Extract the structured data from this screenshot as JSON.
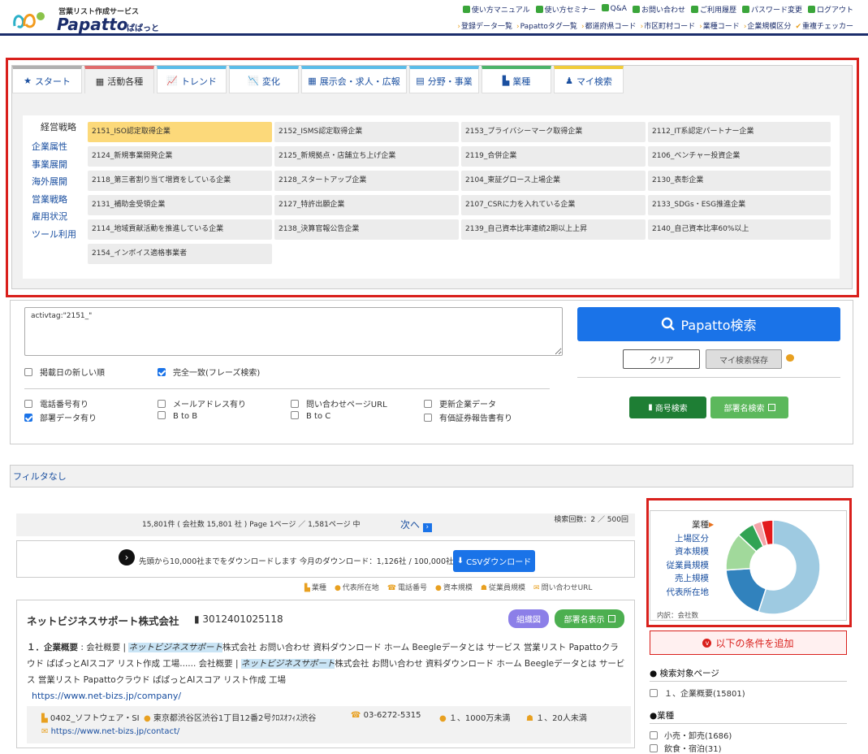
{
  "header": {
    "logo_sub": "営業リスト作成サービス",
    "logo_name": "Papatto",
    "logo_name2": "ぱぱっと",
    "nav_top": [
      "使い方マニュアル",
      "使い方セミナー",
      "Q&A",
      "お問い合わせ",
      "ご利用履歴",
      "パスワード変更",
      "ログアウト"
    ],
    "nav_bottom": [
      "登録データ一覧",
      "Papattoタグ一覧",
      "都道府県コード",
      "市区町村コード",
      "業種コード",
      "企業規模区分",
      "重複チェッカー"
    ]
  },
  "tabs": [
    {
      "label": "スタート",
      "icon": "star-icon",
      "color": "#b0b0b0",
      "width": 86
    },
    {
      "label": "活動各種",
      "icon": "building-icon",
      "color": "#e06c6c",
      "width": 86
    },
    {
      "label": "トレンド",
      "icon": "chart-line-icon",
      "color": "#5bbce8",
      "width": 86
    },
    {
      "label": "変化",
      "icon": "chart-area-icon",
      "color": "#5bbce8",
      "width": 86
    },
    {
      "label": "展示会・求人・広報",
      "icon": "building-icon",
      "color": "#5bbce8",
      "width": 130
    },
    {
      "label": "分野・事業",
      "icon": "grid-icon",
      "color": "#5bbce8",
      "width": 86
    },
    {
      "label": "業種",
      "icon": "factory-icon",
      "color": "#4cb36a",
      "width": 86
    },
    {
      "label": "マイ検索",
      "icon": "user-icon",
      "color": "#f0cc3a",
      "width": 86
    }
  ],
  "side_items": [
    "経営戦略",
    "企業属性",
    "事業展開",
    "海外展開",
    "営業戦略",
    "雇用状況",
    "ツール利用"
  ],
  "tag_cells": [
    "2151_ISO認定取得企業",
    "2152_ISMS認定取得企業",
    "2153_プライバシーマーク取得企業",
    "2112_IT系認定パートナー企業",
    "2124_新規事業開発企業",
    "2125_新規拠点・店舗立ち上げ企業",
    "2119_合併企業",
    "2106_ベンチャー投資企業",
    "2118_第三者割り当て増資をしている企業",
    "2128_スタートアップ企業",
    "2104_東証グロース上場企業",
    "2130_表彰企業",
    "2131_補助金受領企業",
    "2127_特許出願企業",
    "2107_CSRに力を入れている企業",
    "2133_SDGs・ESG推進企業",
    "2114_地域貢献活動を推進している企業",
    "2138_決算官報公告企業",
    "2139_自己資本比率連続2期以上上昇",
    "2140_自己資本比率60%以上",
    "2154_インボイス適格事業者"
  ],
  "search": {
    "query": "activtag:\"2151_\"",
    "btn": "Papatto検索",
    "clear": "クリア",
    "save": "マイ検索保存",
    "opt_newest": "掲載日の新しい順",
    "opt_exact": "完全一致(フレーズ検索)",
    "filters": [
      "電話番号有り",
      "メールアドレス有り",
      "問い合わせページURL",
      "更新企業データ",
      "部署データ有り",
      "B to B",
      "B to C",
      "有価証券報告書有り"
    ],
    "trade_search": "商号検索",
    "dept_search": "部署名検索"
  },
  "filter_label": "フィルタなし",
  "results": {
    "summary": "15,801件 ( 会社数 15,801 社 ) Page 1ページ ／ 1,581ページ 中",
    "next": "次へ",
    "search_count": "検索回数：2 ／ 500回",
    "download_text": "先頭から10,000社までをダウンロードします 今月のダウンロード：1,126社 / 100,000社",
    "csv_btn": "CSVダウンロード",
    "legend": [
      "業種",
      "代表所在地",
      "電話番号",
      "資本規模",
      "従業員規模",
      "問い合わせURL"
    ]
  },
  "card": {
    "company": "ネットビジネスサポート株式会社",
    "corp_no": "3012401025118",
    "org_btn": "組織図",
    "dept_btn": "部署名表示",
    "heading": "１．企業概要",
    "url": "https://www.net-bizs.jp/company/",
    "industry": "0402_ソフトウェア・SI",
    "address": "東京都渋谷区渋谷1丁目12番2号ｸﾛｽｵﾌｨｽ渋谷",
    "phone": "03-6272-5315",
    "capital": "１、1000万未満",
    "employees": "１、20人未満",
    "contact_url": "https://www.net-bizs.jp/contact/"
  },
  "chart_data": {
    "type": "pie",
    "title": "",
    "note": "内訳：会社数",
    "categories": [
      "業種",
      "上場区分",
      "資本規模",
      "従業員規模",
      "売上規模",
      "代表所在地"
    ],
    "values": [
      55,
      19,
      13,
      6,
      3,
      4
    ],
    "colors": [
      "#9ecae1",
      "#3182bd",
      "#a1d99b",
      "#31a354",
      "#f4a3a8",
      "#e31a1c",
      "#fdae6b"
    ],
    "legend": "left"
  },
  "add_condition": "以下の条件を追加",
  "facets": {
    "page_title": "検索対象ページ",
    "page_item": "１、企業概要(15801)",
    "industry_title": "業種",
    "industry_items": [
      "小売・卸売(1686)",
      "飲食・宿泊(31)"
    ]
  }
}
